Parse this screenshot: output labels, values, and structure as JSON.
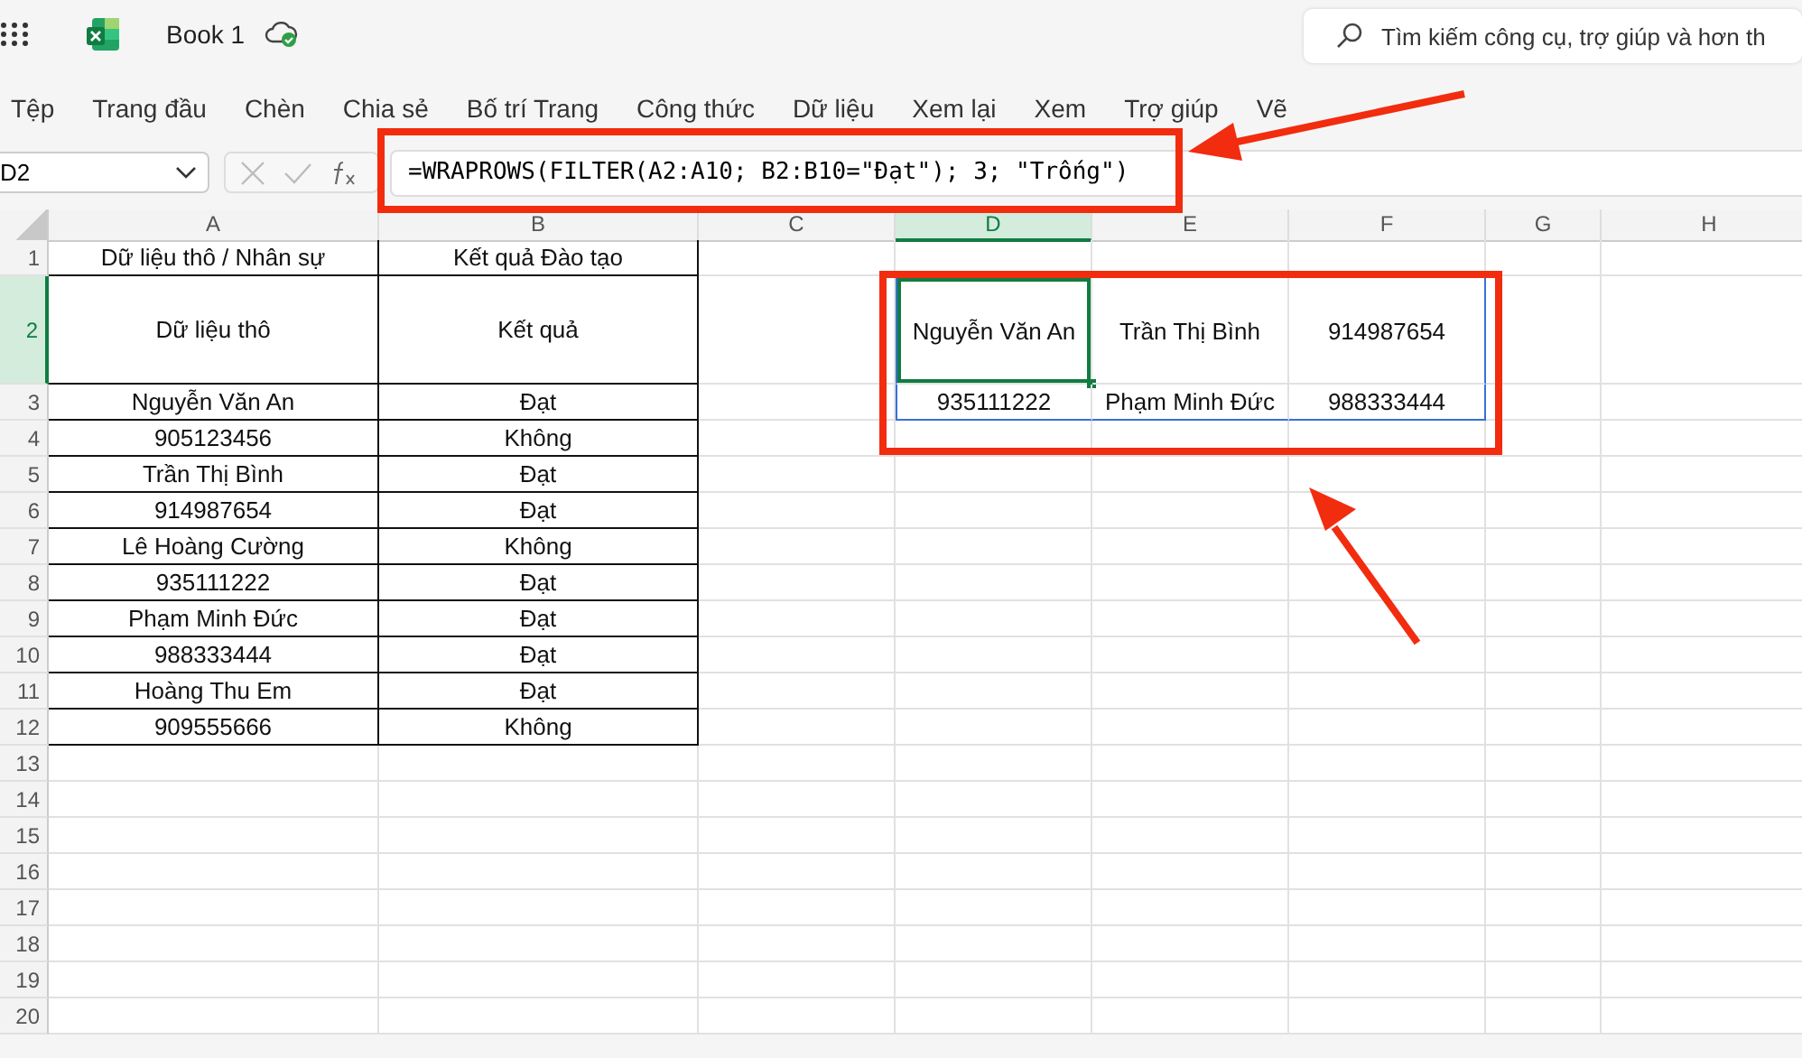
{
  "window": {
    "title": "Book 1"
  },
  "search": {
    "placeholder": "Tìm kiếm công cụ, trợ giúp và hơn th"
  },
  "menu": [
    {
      "label": "Tệp",
      "selected": false
    },
    {
      "label": "Trang đầu",
      "selected": false
    },
    {
      "label": "Chèn",
      "selected": false
    },
    {
      "label": "Chia sẻ",
      "selected": false
    },
    {
      "label": "Bố trí Trang",
      "selected": false
    },
    {
      "label": "Công thức",
      "selected": false
    },
    {
      "label": "Dữ liệu",
      "selected": false
    },
    {
      "label": "Xem lại",
      "selected": false
    },
    {
      "label": "Xem",
      "selected": false
    },
    {
      "label": "Trợ giúp",
      "selected": false
    },
    {
      "label": "Vẽ",
      "selected": false
    }
  ],
  "formula_bar": {
    "name_box": "D2",
    "formula": "=WRAPROWS(FILTER(A2:A10; B2:B10=\"Đạt\"); 3; \"Trống\")"
  },
  "sheet": {
    "columns": [
      {
        "label": "A",
        "selected": false
      },
      {
        "label": "B",
        "selected": false
      },
      {
        "label": "C",
        "selected": false
      },
      {
        "label": "D",
        "selected": true
      },
      {
        "label": "E",
        "selected": false
      },
      {
        "label": "F",
        "selected": false
      },
      {
        "label": "G",
        "selected": false
      },
      {
        "label": "H",
        "selected": false
      }
    ],
    "rows": [
      {
        "label": "1",
        "selected": false,
        "cells": {
          "A": "Dữ liệu thô / Nhân sự",
          "B": "Kết quả Đào tạo"
        }
      },
      {
        "label": "2",
        "selected": true,
        "cells": {
          "A": "Dữ liệu thô",
          "B": "Kết quả",
          "D": "Nguyễn Văn An",
          "E": "Trần Thị Bình",
          "F": "914987654"
        }
      },
      {
        "label": "3",
        "selected": false,
        "cells": {
          "A": "Nguyễn Văn An",
          "B": "Đạt",
          "D": "935111222",
          "E": "Phạm Minh Đức",
          "F": "988333444"
        }
      },
      {
        "label": "4",
        "selected": false,
        "cells": {
          "A": "905123456",
          "B": "Không"
        }
      },
      {
        "label": "5",
        "selected": false,
        "cells": {
          "A": "Trần Thị Bình",
          "B": "Đạt"
        }
      },
      {
        "label": "6",
        "selected": false,
        "cells": {
          "A": "914987654",
          "B": "Đạt"
        }
      },
      {
        "label": "7",
        "selected": false,
        "cells": {
          "A": "Lê Hoàng Cường",
          "B": "Không"
        }
      },
      {
        "label": "8",
        "selected": false,
        "cells": {
          "A": "935111222",
          "B": "Đạt"
        }
      },
      {
        "label": "9",
        "selected": false,
        "cells": {
          "A": "Phạm Minh Đức",
          "B": "Đạt"
        }
      },
      {
        "label": "10",
        "selected": false,
        "cells": {
          "A": "988333444",
          "B": "Đạt"
        }
      },
      {
        "label": "11",
        "selected": false,
        "cells": {
          "A": "Hoàng Thu Em",
          "B": "Đạt"
        }
      },
      {
        "label": "12",
        "selected": false,
        "cells": {
          "A": "909555666",
          "B": "Không"
        }
      },
      {
        "label": "13",
        "selected": false,
        "cells": {}
      },
      {
        "label": "14",
        "selected": false,
        "cells": {}
      },
      {
        "label": "15",
        "selected": false,
        "cells": {}
      },
      {
        "label": "16",
        "selected": false,
        "cells": {}
      },
      {
        "label": "17",
        "selected": false,
        "cells": {}
      },
      {
        "label": "18",
        "selected": false,
        "cells": {}
      },
      {
        "label": "19",
        "selected": false,
        "cells": {}
      },
      {
        "label": "20",
        "selected": false,
        "cells": {}
      }
    ]
  }
}
